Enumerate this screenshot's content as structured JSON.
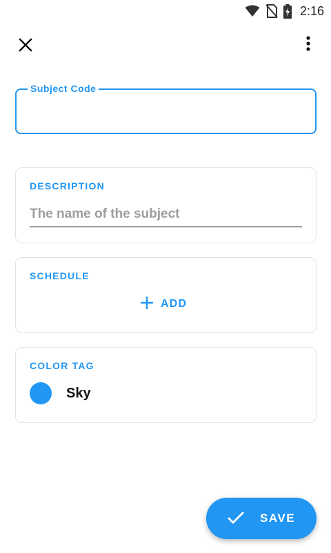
{
  "status_bar": {
    "time": "2:16",
    "icons": [
      "wifi-icon",
      "no-sim-icon",
      "battery-charging-icon"
    ]
  },
  "app_bar": {
    "close_icon": "close-icon",
    "menu_icon": "more-vert-icon"
  },
  "subject_code": {
    "label": "Subject Code",
    "value": ""
  },
  "description": {
    "title": "DESCRIPTION",
    "placeholder": "The name of the subject",
    "value": ""
  },
  "schedule": {
    "title": "SCHEDULE",
    "add_label": "ADD",
    "add_icon": "plus-icon"
  },
  "color_tag": {
    "title": "COLOR TAG",
    "selected_name": "Sky",
    "selected_color": "#2196f3"
  },
  "save_button": {
    "label": "SAVE",
    "icon": "check-icon"
  },
  "colors": {
    "accent": "#2196f3",
    "card_border": "#e3e3e3",
    "placeholder": "#9e9e9e"
  }
}
